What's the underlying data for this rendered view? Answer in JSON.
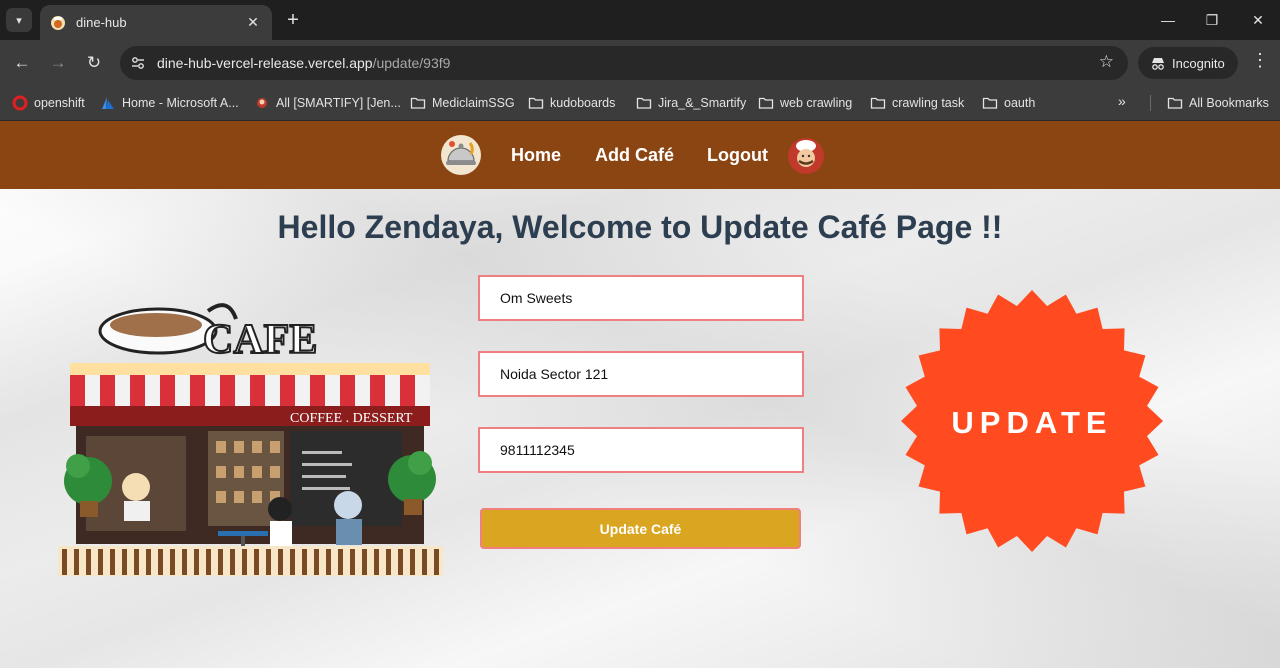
{
  "browser": {
    "tab_title": "dine-hub",
    "url_host": "dine-hub-vercel-release.vercel.app",
    "url_path": "/update/93f9",
    "incognito_label": "Incognito",
    "bookmarks": [
      {
        "label": "openshift",
        "icon": "openshift-icon"
      },
      {
        "label": "Home - Microsoft A...",
        "icon": "azure-icon"
      },
      {
        "label": "All [SMARTIFY] [Jen...",
        "icon": "jenkins-icon"
      },
      {
        "label": "MediclaimSSG",
        "icon": "folder-icon"
      },
      {
        "label": "kudoboards",
        "icon": "folder-icon"
      },
      {
        "label": "Jira_&_Smartify",
        "icon": "folder-icon"
      },
      {
        "label": "web crawling",
        "icon": "folder-icon"
      },
      {
        "label": "crawling task",
        "icon": "folder-icon"
      },
      {
        "label": "oauth",
        "icon": "folder-icon"
      }
    ],
    "all_bookmarks_label": "All Bookmarks"
  },
  "navbar": {
    "links": [
      "Home",
      "Add Café",
      "Logout"
    ]
  },
  "page": {
    "heading": "Hello Zendaya, Welcome to Update Café Page !!",
    "illustration_text": {
      "sign": "CAFE",
      "awning": "COFFEE . DESSERT"
    },
    "badge_text": "UPDATE"
  },
  "form": {
    "name_value": "Om Sweets",
    "location_value": "Noida Sector 121",
    "phone_value": "9811112345",
    "submit_label": "Update Café"
  },
  "colors": {
    "navbar": "#8b4513",
    "heading": "#2c3e50",
    "field_border": "#f08080",
    "button": "#daa520",
    "badge": "#ff4b1f"
  }
}
